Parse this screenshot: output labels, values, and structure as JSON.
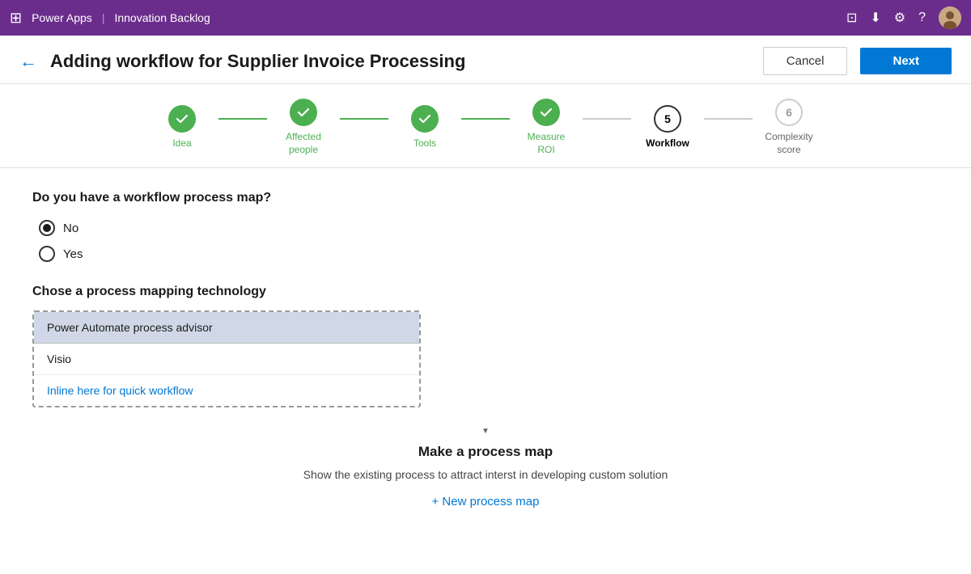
{
  "topbar": {
    "grid_icon": "⊞",
    "app_name": "Power Apps",
    "separator": "|",
    "module_name": "Innovation Backlog"
  },
  "header": {
    "title": "Adding workflow for Supplier Invoice Processing",
    "cancel_label": "Cancel",
    "next_label": "Next"
  },
  "stepper": {
    "steps": [
      {
        "id": "idea",
        "label": "Idea",
        "state": "completed",
        "number": "✓"
      },
      {
        "id": "affected-people",
        "label": "Affected\npeople",
        "state": "completed",
        "number": "✓"
      },
      {
        "id": "tools",
        "label": "Tools",
        "state": "completed",
        "number": "✓"
      },
      {
        "id": "measure-roi",
        "label": "Measure\nROI",
        "state": "completed",
        "number": "✓"
      },
      {
        "id": "workflow",
        "label": "Workflow",
        "state": "active",
        "number": "5"
      },
      {
        "id": "complexity-score",
        "label": "Complexity\nscore",
        "state": "inactive",
        "number": "6"
      }
    ]
  },
  "workflow_question": {
    "question": "Do you have a workflow process map?",
    "options": [
      {
        "id": "no",
        "label": "No",
        "selected": true
      },
      {
        "id": "yes",
        "label": "Yes",
        "selected": false
      }
    ]
  },
  "process_mapping": {
    "title": "Chose a process mapping technology",
    "selected_option": "Power Automate process advisor",
    "options": [
      {
        "id": "power-automate",
        "label": "Power Automate process advisor"
      },
      {
        "id": "visio",
        "label": "Visio"
      },
      {
        "id": "inline",
        "label": "Inline here for quick workflow",
        "is_link": true
      }
    ]
  },
  "process_map_section": {
    "title": "Make a process map",
    "description": "Show the existing process to attract interst in\ndeveloping custom solution",
    "new_process_label": "+ New process map"
  }
}
